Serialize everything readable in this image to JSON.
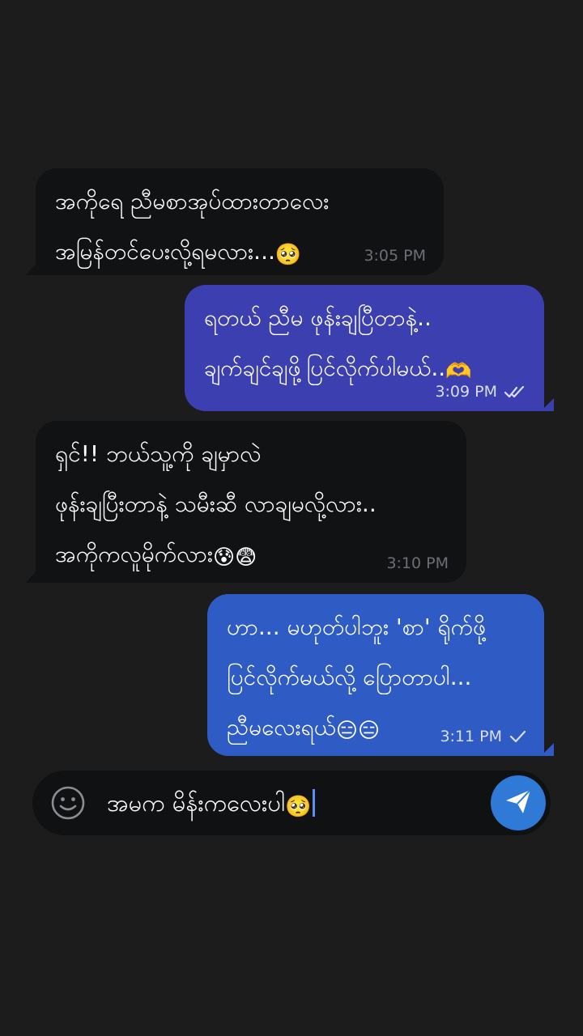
{
  "conversation": {
    "messages": [
      {
        "direction": "incoming",
        "lines": [
          "အကိုရေ ညီမစာအုပ်ထားတာလေး",
          "အမြန်တင်ပေးလို့ရမလား..."
        ],
        "trailing_emoji": "🥺",
        "time": "3:05 PM"
      },
      {
        "direction": "outgoing",
        "lines": [
          "ရတယ် ညီမ ဖုန်းချပြီတာနဲ့..",
          "ချက်ချင်ချဖို့ပြင်လိုက်ပါမယ်.."
        ],
        "trailing_emoji": "🫶",
        "time": "3:09 PM",
        "status_icon": "double-check-icon"
      },
      {
        "direction": "incoming",
        "lines": [
          "ရှင်!! ဘယ်သူ့ကို ချမှာလဲ",
          "ဖုန်းချပြီးတာနဲ့ သမီးဆီ လာချမလို့လား..",
          "အကိုကလူမိုက်လား"
        ],
        "trailing_emoji": "😰😨",
        "time": "3:10 PM"
      },
      {
        "direction": "outgoing",
        "lines": [
          "ဟာ... မဟုတ်ပါဘူး 'စာ' ရိုက်ဖို့",
          "ပြင်လိုက်မယ်လို့ ပြောတာပါ...",
          "ညီမလေးရယ်"
        ],
        "trailing_emoji": "😑😑",
        "time": "3:11 PM",
        "status_icon": "single-check-icon"
      }
    ]
  },
  "composer": {
    "text": "အမက မိန်းကလေးပါ",
    "trailing_emoji": "🥺",
    "emoji_button_icon": "smile-icon",
    "send_button_icon": "send-icon"
  },
  "colors": {
    "background": "#1c1c1c",
    "incoming_bubble": "#111214",
    "outgoing_bubble_purple": "#3b3fb0",
    "outgoing_bubble_blue": "#2f5bc4",
    "send_button": "#2f7ad6"
  }
}
